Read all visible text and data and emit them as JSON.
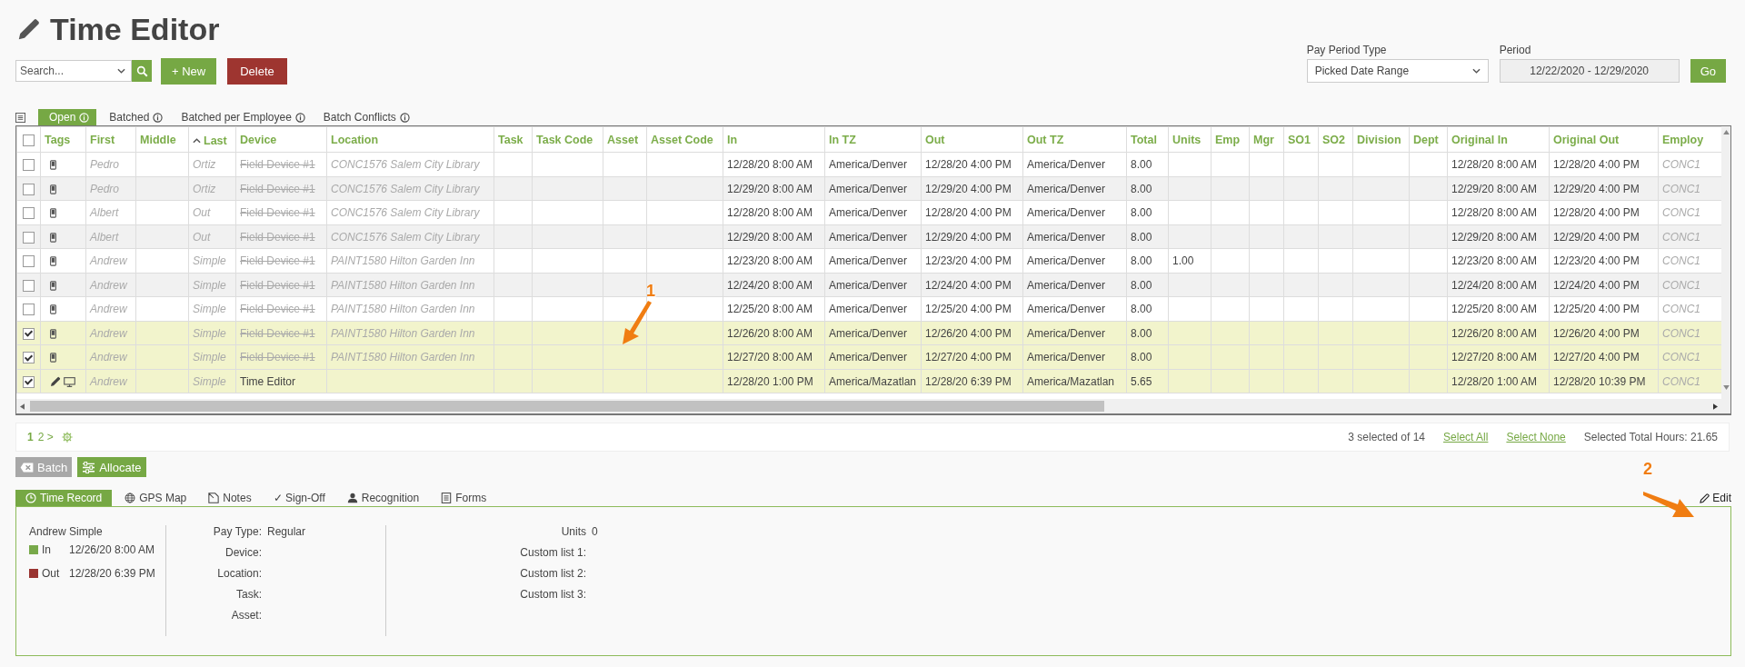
{
  "page": {
    "title": "Time Editor"
  },
  "toolbar": {
    "search": {
      "placeholder": "Search..."
    },
    "new_button": "+ New",
    "delete_button": "Delete"
  },
  "period_filter": {
    "type_label": "Pay Period Type",
    "type_value": "Picked Date Range",
    "period_label": "Period",
    "period_value": "12/22/2020 - 12/29/2020",
    "go_button": "Go"
  },
  "view_tabs": [
    {
      "label": "Open",
      "selected": true
    },
    {
      "label": "Batched",
      "selected": false
    },
    {
      "label": "Batched per Employee",
      "selected": false
    },
    {
      "label": "Batch Conflicts",
      "selected": false
    }
  ],
  "table": {
    "header_checked": false,
    "columns": [
      {
        "label": "Tags"
      },
      {
        "label": "First"
      },
      {
        "label": "Middle"
      },
      {
        "label": "Last",
        "sorted": true
      },
      {
        "label": "Device"
      },
      {
        "label": "Location"
      },
      {
        "label": "Task"
      },
      {
        "label": "Task Code"
      },
      {
        "label": "Asset"
      },
      {
        "label": "Asset Code"
      },
      {
        "label": "In"
      },
      {
        "label": "In TZ"
      },
      {
        "label": "Out"
      },
      {
        "label": "Out TZ"
      },
      {
        "label": "Total"
      },
      {
        "label": "Units"
      },
      {
        "label": "Emp"
      },
      {
        "label": "Mgr"
      },
      {
        "label": "SO1"
      },
      {
        "label": "SO2"
      },
      {
        "label": "Division"
      },
      {
        "label": "Dept"
      },
      {
        "label": "Original In"
      },
      {
        "label": "Original Out"
      },
      {
        "label": "Employ"
      }
    ],
    "rows": [
      {
        "selected": false,
        "kind": "phone",
        "first": "Pedro",
        "last": "Ortiz",
        "device": "Field Device #1",
        "device_deleted": true,
        "location": "CONC1576 Salem City Library",
        "in": "12/28/20 8:00 AM",
        "in_tz": "America/Denver",
        "out": "12/28/20 4:00 PM",
        "out_tz": "America/Denver",
        "total": "8.00",
        "orig_in": "12/28/20 8:00 AM",
        "orig_out": "12/28/20 4:00 PM",
        "employ": "CONC1"
      },
      {
        "selected": false,
        "kind": "phone",
        "first": "Pedro",
        "last": "Ortiz",
        "device": "Field Device #1",
        "device_deleted": true,
        "location": "CONC1576 Salem City Library",
        "in": "12/29/20 8:00 AM",
        "in_tz": "America/Denver",
        "out": "12/29/20 4:00 PM",
        "out_tz": "America/Denver",
        "total": "8.00",
        "orig_in": "12/29/20 8:00 AM",
        "orig_out": "12/29/20 4:00 PM",
        "employ": "CONC1"
      },
      {
        "selected": false,
        "kind": "phone",
        "first": "Albert",
        "last": "Out",
        "device": "Field Device #1",
        "device_deleted": true,
        "location": "CONC1576 Salem City Library",
        "in": "12/28/20 8:00 AM",
        "in_tz": "America/Denver",
        "out": "12/28/20 4:00 PM",
        "out_tz": "America/Denver",
        "total": "8.00",
        "orig_in": "12/28/20 8:00 AM",
        "orig_out": "12/28/20 4:00 PM",
        "employ": "CONC1"
      },
      {
        "selected": false,
        "kind": "phone",
        "first": "Albert",
        "last": "Out",
        "device": "Field Device #1",
        "device_deleted": true,
        "location": "CONC1576 Salem City Library",
        "in": "12/29/20 8:00 AM",
        "in_tz": "America/Denver",
        "out": "12/29/20 4:00 PM",
        "out_tz": "America/Denver",
        "total": "8.00",
        "orig_in": "12/29/20 8:00 AM",
        "orig_out": "12/29/20 4:00 PM",
        "employ": "CONC1"
      },
      {
        "selected": false,
        "kind": "phone",
        "first": "Andrew",
        "last": "Simple",
        "device": "Field Device #1",
        "device_deleted": true,
        "location": "PAINT1580 Hilton Garden Inn",
        "in": "12/23/20 8:00 AM",
        "in_tz": "America/Denver",
        "out": "12/23/20 4:00 PM",
        "out_tz": "America/Denver",
        "total": "8.00",
        "units": "1.00",
        "orig_in": "12/23/20 8:00 AM",
        "orig_out": "12/23/20 4:00 PM",
        "employ": "CONC1"
      },
      {
        "selected": false,
        "kind": "phone",
        "first": "Andrew",
        "last": "Simple",
        "device": "Field Device #1",
        "device_deleted": true,
        "location": "PAINT1580 Hilton Garden Inn",
        "in": "12/24/20 8:00 AM",
        "in_tz": "America/Denver",
        "out": "12/24/20 4:00 PM",
        "out_tz": "America/Denver",
        "total": "8.00",
        "orig_in": "12/24/20 8:00 AM",
        "orig_out": "12/24/20 4:00 PM",
        "employ": "CONC1"
      },
      {
        "selected": false,
        "kind": "phone",
        "first": "Andrew",
        "last": "Simple",
        "device": "Field Device #1",
        "device_deleted": true,
        "location": "PAINT1580 Hilton Garden Inn",
        "in": "12/25/20 8:00 AM",
        "in_tz": "America/Denver",
        "out": "12/25/20 4:00 PM",
        "out_tz": "America/Denver",
        "total": "8.00",
        "orig_in": "12/25/20 8:00 AM",
        "orig_out": "12/25/20 4:00 PM",
        "employ": "CONC1"
      },
      {
        "selected": true,
        "kind": "phone",
        "first": "Andrew",
        "last": "Simple",
        "device": "Field Device #1",
        "device_deleted": true,
        "location": "PAINT1580 Hilton Garden Inn",
        "in": "12/26/20 8:00 AM",
        "in_tz": "America/Denver",
        "out": "12/26/20 4:00 PM",
        "out_tz": "America/Denver",
        "total": "8.00",
        "orig_in": "12/26/20 8:00 AM",
        "orig_out": "12/26/20 4:00 PM",
        "employ": "CONC1"
      },
      {
        "selected": true,
        "kind": "phone",
        "first": "Andrew",
        "last": "Simple",
        "device": "Field Device #1",
        "device_deleted": true,
        "location": "PAINT1580 Hilton Garden Inn",
        "in": "12/27/20 8:00 AM",
        "in_tz": "America/Denver",
        "out": "12/27/20 4:00 PM",
        "out_tz": "America/Denver",
        "total": "8.00",
        "orig_in": "12/27/20 8:00 AM",
        "orig_out": "12/27/20 4:00 PM",
        "employ": "CONC1"
      },
      {
        "selected": true,
        "kind": "editor",
        "first": "Andrew",
        "last": "Simple",
        "device": "Time Editor",
        "device_deleted": false,
        "in": "12/28/20 1:00 PM",
        "in_tz": "America/Mazatlan",
        "out": "12/28/20 6:39 PM",
        "out_tz": "America/Mazatlan",
        "total": "5.65",
        "orig_in": "12/28/20 1:00 AM",
        "orig_out": "12/28/20 10:39 PM",
        "employ": "CONC1"
      }
    ]
  },
  "pager": {
    "pages": [
      {
        "label": "1",
        "selected": true
      },
      {
        "label": "2 >",
        "selected": false
      }
    ],
    "summary": "3 selected of 14",
    "select_all": "Select All",
    "select_none": "Select None",
    "total_hours": "Selected Total Hours: 21.65"
  },
  "actions": [
    {
      "label": "Batch",
      "disabled": true
    },
    {
      "label": "Allocate",
      "disabled": false
    }
  ],
  "detail_tabs": [
    {
      "label": "Time Record",
      "selected": true
    },
    {
      "label": "GPS Map",
      "selected": false
    },
    {
      "label": "Notes",
      "selected": false
    },
    {
      "label": "✓ Sign-Off",
      "selected": false
    },
    {
      "label": "Recognition",
      "selected": false
    },
    {
      "label": "Forms",
      "selected": false
    }
  ],
  "edit_link": "Edit",
  "detail": {
    "employee": "Andrew Simple",
    "punches": [
      {
        "label": "In",
        "time": "12/26/20 8:00 AM",
        "color": "#78a94a"
      },
      {
        "label": "Out",
        "time": "12/28/20 6:39 PM",
        "color": "#9a3431"
      }
    ],
    "fields": [
      {
        "label": "Pay Type:",
        "value": "Regular"
      },
      {
        "label": "Device:"
      },
      {
        "label": "Location:"
      },
      {
        "label": "Task:"
      },
      {
        "label": "Asset:"
      }
    ],
    "extra_fields": [
      {
        "label": "Units",
        "value": "0"
      },
      {
        "label": "Custom list 1:"
      },
      {
        "label": "Custom list 2:"
      },
      {
        "label": "Custom list 3:"
      }
    ]
  },
  "callouts": [
    {
      "label": "1"
    },
    {
      "label": "2"
    }
  ]
}
